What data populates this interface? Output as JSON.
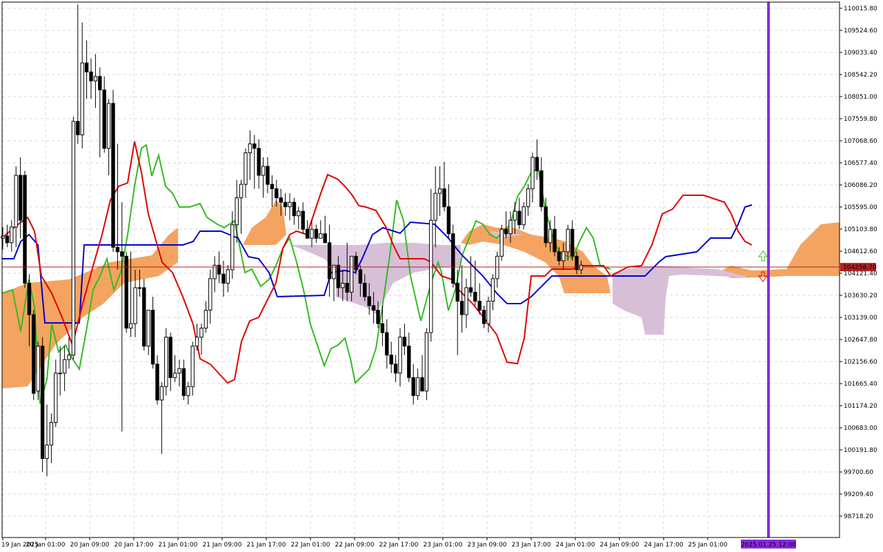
{
  "chart_data": {
    "type": "candlestick",
    "indicator": "Ichimoku Kinko Hyo",
    "grid": true,
    "y_ticks": [
      "110015.80",
      "109524.60",
      "109033.40",
      "108542.20",
      "108051.00",
      "107559.80",
      "107068.60",
      "106577.40",
      "106086.20",
      "105595.00",
      "105103.80",
      "104612.60",
      "104121.40",
      "103630.20",
      "103139.00",
      "102647.80",
      "102156.60",
      "101665.40",
      "101174.20",
      "100683.00",
      "100191.80",
      "99700.60",
      "99209.40",
      "98718.20"
    ],
    "y_tick_values": [
      110015.8,
      109524.6,
      109033.4,
      108542.2,
      108051.0,
      107559.8,
      107068.6,
      106577.4,
      106086.2,
      105595.0,
      105103.8,
      104612.6,
      104121.4,
      103630.2,
      103139.0,
      102647.8,
      102156.6,
      101665.4,
      101174.2,
      100683.0,
      100191.8,
      99700.6,
      99209.4,
      98718.2
    ],
    "x_ticks": [
      "19 Jan 2025",
      "20 Jan 01:00",
      "20 Jan 09:00",
      "20 Jan 17:00",
      "21 Jan 01:00",
      "21 Jan 09:00",
      "21 Jan 17:00",
      "22 Jan 01:00",
      "22 Jan 09:00",
      "22 Jan 17:00",
      "23 Jan 01:00",
      "23 Jan 09:00",
      "23 Jan 17:00",
      "24 Jan 01:00",
      "24 Jan 09:00",
      "24 Jan 17:00",
      "25 Jan 01:00"
    ],
    "current_price_label": "104258.70",
    "current_price": 104258.7,
    "time_marker_label": "2025.01.25 12:00",
    "colors": {
      "tenkan": "#e00000",
      "kijun": "#0000cc",
      "chikou": "#33bb22",
      "kumo_bull": "#f4a460",
      "kumo_bear": "#d8bfd8",
      "price_line": "#b22222",
      "time_marker": "#8a2be2",
      "grid": "#d8d8d8",
      "candle_bull": "#ffffff",
      "candle_bear": "#000000"
    },
    "candles_ohlc": [
      [
        104900,
        105150,
        104650,
        104950
      ],
      [
        104950,
        105200,
        104700,
        104800
      ],
      [
        104800,
        105300,
        104600,
        105150
      ],
      [
        105150,
        106500,
        104700,
        106300
      ],
      [
        106300,
        106700,
        104900,
        105300
      ],
      [
        106300,
        106400,
        103800,
        103900
      ],
      [
        103900,
        104100,
        102500,
        103200
      ],
      [
        103200,
        103300,
        101300,
        101450
      ],
      [
        101500,
        102600,
        101300,
        102500
      ],
      [
        102500,
        102700,
        99700,
        100000
      ],
      [
        100000,
        101200,
        99600,
        100300
      ],
      [
        100300,
        101000,
        99900,
        100800
      ],
      [
        100800,
        102200,
        100700,
        101900
      ],
      [
        101900,
        102500,
        101400,
        101900
      ],
      [
        101900,
        102500,
        101500,
        102200
      ],
      [
        102200,
        102700,
        102000,
        102300
      ],
      [
        102300,
        107600,
        102200,
        107500
      ],
      [
        107500,
        110100,
        107000,
        107200
      ],
      [
        107200,
        109700,
        106900,
        108800
      ],
      [
        108800,
        109300,
        108000,
        108600
      ],
      [
        108600,
        108900,
        108000,
        108400
      ],
      [
        108400,
        109000,
        107800,
        108500
      ],
      [
        108500,
        108700,
        106700,
        108200
      ],
      [
        108200,
        108500,
        106800,
        106900
      ],
      [
        106900,
        108000,
        106300,
        107900
      ],
      [
        107900,
        108200,
        104600,
        104700
      ],
      [
        104700,
        107000,
        104200,
        104600
      ],
      [
        104600,
        105700,
        100600,
        104500
      ],
      [
        104500,
        104600,
        102800,
        102900
      ],
      [
        102900,
        104600,
        102700,
        103000
      ],
      [
        103000,
        104200,
        102700,
        103800
      ],
      [
        103800,
        104200,
        103600,
        103800
      ],
      [
        103800,
        104000,
        102400,
        102500
      ],
      [
        102500,
        103300,
        102300,
        103300
      ],
      [
        103300,
        103600,
        102000,
        102100
      ],
      [
        102100,
        102300,
        101200,
        101300
      ],
      [
        101300,
        101700,
        100100,
        101600
      ],
      [
        101600,
        102900,
        101400,
        102700
      ],
      [
        102700,
        102800,
        101500,
        101800
      ],
      [
        101800,
        102300,
        101700,
        101900
      ],
      [
        101900,
        102200,
        101600,
        102000
      ],
      [
        102000,
        102200,
        101300,
        101400
      ],
      [
        101400,
        101700,
        101200,
        101600
      ],
      [
        101600,
        102600,
        101400,
        102500
      ],
      [
        102500,
        103000,
        102400,
        102700
      ],
      [
        102700,
        103000,
        102300,
        102900
      ],
      [
        102900,
        103500,
        102800,
        103300
      ],
      [
        103300,
        104200,
        103000,
        104000
      ],
      [
        104000,
        104500,
        103700,
        104300
      ],
      [
        104300,
        104600,
        103900,
        104100
      ],
      [
        104100,
        104400,
        103600,
        103900
      ],
      [
        103900,
        104300,
        103700,
        104200
      ],
      [
        104200,
        105500,
        104000,
        105200
      ],
      [
        105200,
        106200,
        104800,
        105800
      ],
      [
        105800,
        106200,
        105000,
        106100
      ],
      [
        106100,
        106900,
        105800,
        106800
      ],
      [
        106800,
        107300,
        106200,
        107000
      ],
      [
        107000,
        107200,
        106000,
        106900
      ],
      [
        106900,
        107100,
        106000,
        106300
      ],
      [
        106300,
        106700,
        105800,
        106500
      ],
      [
        106500,
        106700,
        105900,
        106100
      ],
      [
        106100,
        106300,
        105600,
        106000
      ],
      [
        106000,
        106200,
        105600,
        105800
      ],
      [
        105800,
        106000,
        105400,
        105700
      ],
      [
        105700,
        105900,
        105400,
        105600
      ],
      [
        105600,
        105900,
        105300,
        105700
      ],
      [
        105700,
        105800,
        105200,
        105400
      ],
      [
        105400,
        105600,
        105100,
        105500
      ],
      [
        105500,
        105700,
        105000,
        105100
      ],
      [
        105100,
        105300,
        104900,
        104900
      ],
      [
        104900,
        105300,
        104700,
        105100
      ],
      [
        105100,
        105200,
        104800,
        104900
      ],
      [
        104900,
        105300,
        104900,
        105000
      ],
      [
        105000,
        105400,
        104800,
        104800
      ],
      [
        104800,
        105200,
        103600,
        104000
      ],
      [
        104000,
        104300,
        103500,
        104300
      ],
      [
        104300,
        104500,
        103600,
        103800
      ],
      [
        103800,
        104200,
        103500,
        103900
      ],
      [
        103900,
        104800,
        103500,
        103700
      ],
      [
        103700,
        104500,
        103500,
        104500
      ],
      [
        104500,
        104600,
        104100,
        104200
      ],
      [
        104200,
        104300,
        103600,
        103900
      ],
      [
        103900,
        104100,
        103500,
        103600
      ],
      [
        103600,
        103900,
        103200,
        103400
      ],
      [
        103400,
        103700,
        103000,
        103300
      ],
      [
        103300,
        103500,
        102900,
        103000
      ],
      [
        103000,
        103400,
        102500,
        102800
      ],
      [
        102800,
        103100,
        102000,
        102300
      ],
      [
        102300,
        102600,
        101900,
        102100
      ],
      [
        102100,
        102300,
        101700,
        101900
      ],
      [
        101900,
        102900,
        101600,
        102700
      ],
      [
        102700,
        103000,
        102300,
        102500
      ],
      [
        102500,
        102800,
        101700,
        101800
      ],
      [
        101800,
        102100,
        101200,
        101400
      ],
      [
        101400,
        102000,
        101300,
        101800
      ],
      [
        101800,
        102300,
        101500,
        101500
      ],
      [
        101500,
        102900,
        101300,
        102800
      ],
      [
        102800,
        106000,
        102600,
        105300
      ],
      [
        105300,
        106500,
        104700,
        105900
      ],
      [
        105900,
        106500,
        105400,
        106000
      ],
      [
        106000,
        106600,
        105500,
        105600
      ],
      [
        105600,
        106100,
        104900,
        105000
      ],
      [
        105000,
        105200,
        103800,
        103900
      ],
      [
        103900,
        104200,
        102300,
        103500
      ],
      [
        103500,
        104300,
        102800,
        103200
      ],
      [
        103200,
        104000,
        102900,
        103800
      ],
      [
        103800,
        104500,
        103600,
        103700
      ],
      [
        103700,
        104400,
        103400,
        103500
      ],
      [
        103500,
        103900,
        103200,
        103300
      ],
      [
        103300,
        103400,
        102900,
        103000
      ],
      [
        103000,
        103600,
        102800,
        103500
      ],
      [
        103500,
        104100,
        103300,
        104000
      ],
      [
        104000,
        104600,
        103800,
        104500
      ],
      [
        104500,
        105200,
        104400,
        105100
      ],
      [
        105100,
        105500,
        104900,
        105000
      ],
      [
        105000,
        105500,
        104800,
        105300
      ],
      [
        105300,
        105700,
        105000,
        105500
      ],
      [
        105500,
        105800,
        105100,
        105200
      ],
      [
        105200,
        105700,
        105100,
        105600
      ],
      [
        105600,
        106100,
        105400,
        106000
      ],
      [
        106000,
        106800,
        105700,
        106700
      ],
      [
        106700,
        107100,
        106200,
        106400
      ],
      [
        106400,
        106700,
        105500,
        105600
      ],
      [
        105600,
        105800,
        104700,
        104800
      ],
      [
        104800,
        105300,
        104600,
        105100
      ],
      [
        105100,
        105400,
        104500,
        104600
      ],
      [
        104600,
        104700,
        104300,
        104400
      ],
      [
        104400,
        104800,
        104200,
        104600
      ],
      [
        104600,
        105200,
        104400,
        105100
      ],
      [
        105100,
        105300,
        104400,
        104500
      ],
      [
        104500,
        104600,
        104100,
        104200
      ],
      [
        104200,
        104400,
        104100,
        104300
      ]
    ]
  }
}
